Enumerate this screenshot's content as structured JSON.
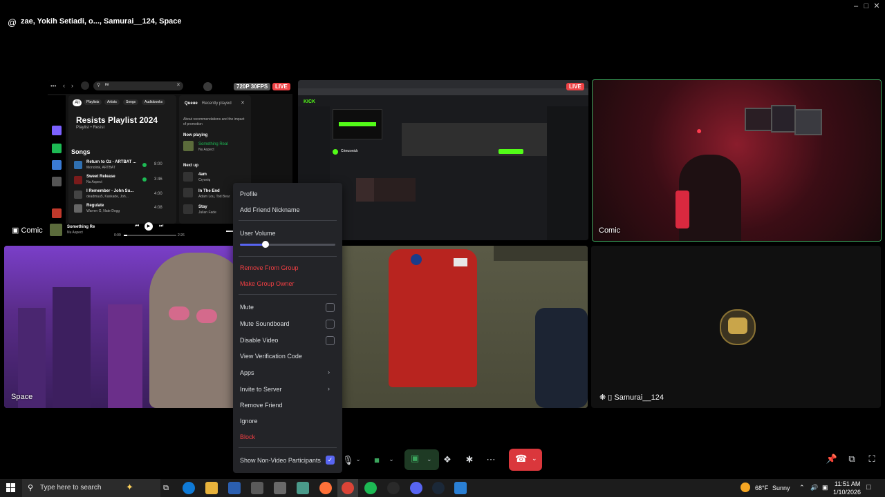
{
  "window": {
    "title": "zae, Yokih Setiadi, o..., Samurai__124, Space",
    "controls": [
      "minimize",
      "maximize",
      "close"
    ]
  },
  "tiles": {
    "stream1": {
      "quality_badge": "720P 30FPS",
      "live_badge": "LIVE",
      "streamer_name": "Comic",
      "spotify": {
        "search_value": "re",
        "filters": [
          "All",
          "Playlists",
          "Artists",
          "Songs",
          "Audiobooks"
        ],
        "playlist_title": "Resists Playlist 2024",
        "playlist_subtitle": "Playlist • Resist",
        "section_songs": "Songs",
        "songs": [
          {
            "title": "Return to Oz - ARTBAT ...",
            "artist": "Monolink, ARTBAT",
            "duration": "8:00"
          },
          {
            "title": "Sweet Release",
            "artist": "Nu Aspect",
            "duration": "3:46"
          },
          {
            "title": "I Remember - John Su...",
            "artist": "deadmau5, Kaskade, Joh...",
            "duration": "4:00"
          },
          {
            "title": "Regulate",
            "artist": "Warren G, Nate Dogg",
            "duration": "4:08"
          }
        ],
        "queue_tabs": [
          "Queue",
          "Recently played"
        ],
        "queue_note": "About recommendations and the impact of promotion",
        "now_playing_label": "Now playing",
        "now_playing": {
          "title": "Something Real",
          "artist": "Nu Aspect"
        },
        "next_up_label": "Next up",
        "next_up": [
          {
            "title": "4am",
            "artist": "Cryoniq"
          },
          {
            "title": "In The End",
            "artist": "Adam Lou, Tod Bear"
          },
          {
            "title": "Stay",
            "artist": "Julian Fade"
          }
        ],
        "player": {
          "title": "Something Re",
          "artist": "Nu Aspect",
          "elapsed": "0:09",
          "total": "2:26"
        }
      }
    },
    "stream2": {
      "live_badge": "LIVE",
      "streamer_name": "Crimzonick",
      "site_name": "KICK"
    },
    "comic": {
      "name": "Comic"
    },
    "space": {
      "name": "Space"
    },
    "samurai": {
      "name": "Samurai__124"
    }
  },
  "context_menu": {
    "profile": "Profile",
    "add_nickname": "Add Friend Nickname",
    "user_volume": "User Volume",
    "user_volume_level": 0.27,
    "remove_from_group": "Remove From Group",
    "make_group_owner": "Make Group Owner",
    "mute": "Mute",
    "mute_soundboard": "Mute Soundboard",
    "disable_video": "Disable Video",
    "view_verification_code": "View Verification Code",
    "apps": "Apps",
    "invite_to_server": "Invite to Server",
    "remove_friend": "Remove Friend",
    "ignore": "Ignore",
    "block": "Block",
    "show_non_video": "Show Non-Video Participants",
    "show_non_video_checked": true
  },
  "taskbar": {
    "search_placeholder": "Type here to search",
    "weather_temp": "68°F",
    "weather_text": "Sunny",
    "time": "11:51 AM",
    "date": "1/10/2026"
  },
  "colors": {
    "accent": "#5865f2",
    "danger": "#f23f43",
    "speaking": "#3ba55d",
    "hangup": "#da373c",
    "live": "#ed4245"
  }
}
